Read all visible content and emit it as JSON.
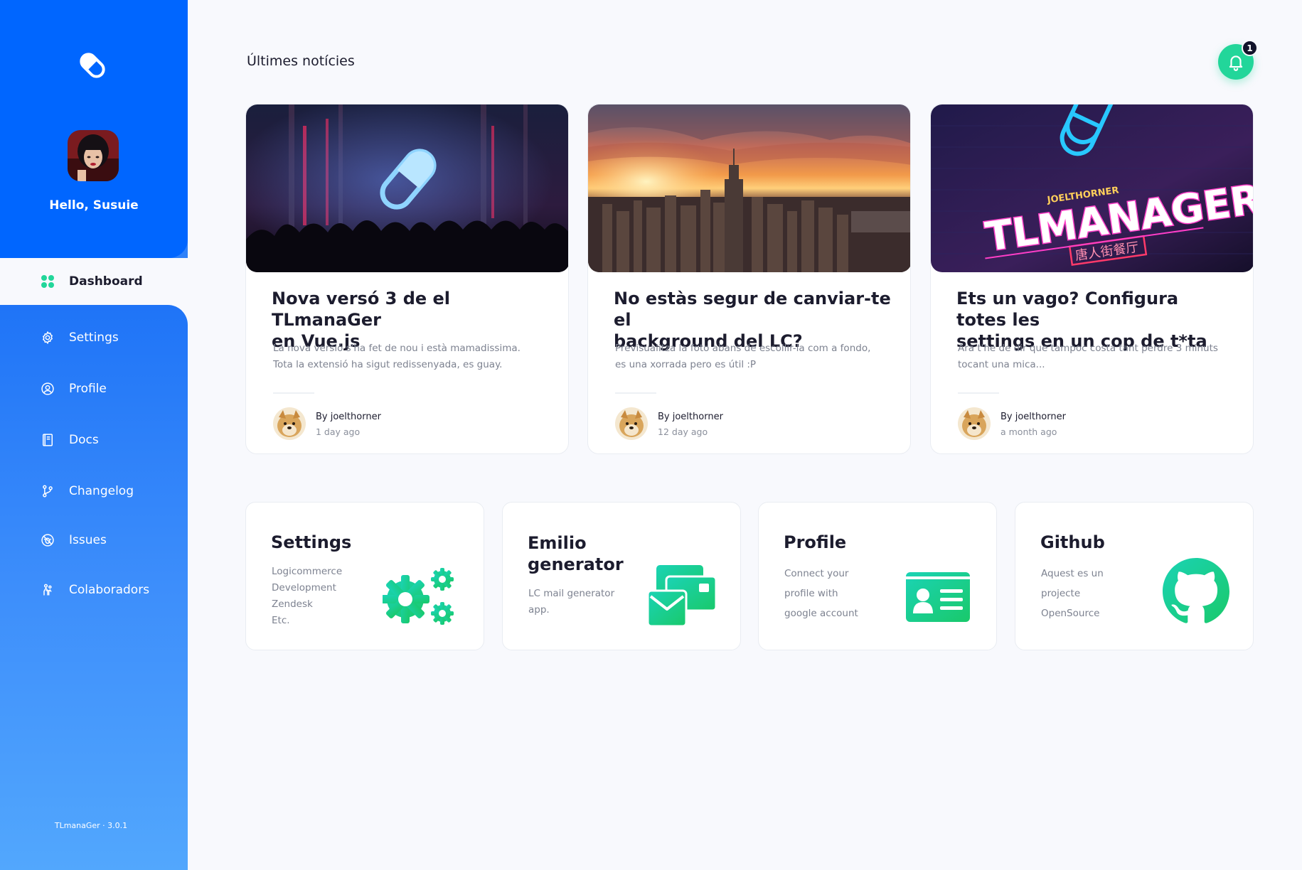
{
  "sidebar": {
    "greeting": "Hello, Susuie",
    "version": "TLmanaGer · 3.0.1",
    "items": [
      {
        "label": "Dashboard"
      },
      {
        "label": "Settings"
      },
      {
        "label": "Profile"
      },
      {
        "label": "Docs"
      },
      {
        "label": "Changelog"
      },
      {
        "label": "Issues"
      },
      {
        "label": "Colaboradors"
      }
    ]
  },
  "header": {
    "title": "Últimes notícies",
    "notification_count": "1"
  },
  "news": [
    {
      "title_l1": "Nova versó 3 de el TLmanaGer",
      "title_l2": "en Vue.js",
      "desc_l1": "La nova versió s'ha fet de nou i està mamadissima.",
      "desc_l2": "Tota la extensió ha sigut redissenyada, es guay.",
      "author": "By joelthorner",
      "time": "1 day ago"
    },
    {
      "title_l1": "No estàs segur de canviar-te el",
      "title_l2": "background del LC?",
      "desc_l1": "Previsualitza  la foto abans de escollir-la com a fondo,",
      "desc_l2": "es una xorrada pero es útil :P",
      "author": "By joelthorner",
      "time": "12 day ago"
    },
    {
      "title_l1": "Ets un vago? Configura totes les",
      "title_l2": "settings en un cop de t*ta",
      "desc_l1": "Ara t'he de dir que tampoc costa tant perdre 3 minuts",
      "desc_l2": "tocant una mica...",
      "author": "By joelthorner",
      "time": "a month ago",
      "img_text_top": "JOELTHORNER",
      "img_text_main": "TLMANAGER",
      "img_text_sub": "唐人街餐厅"
    }
  ],
  "tools": [
    {
      "title_l1": "Settings",
      "title_l2": "",
      "lines": [
        "Logicommerce",
        "Development",
        "Zendesk",
        "Etc."
      ]
    },
    {
      "title_l1": "Emilio",
      "title_l2": "generator",
      "lines": [
        "LC mail  generator",
        "app."
      ]
    },
    {
      "title_l1": "Profile",
      "title_l2": "",
      "lines": [
        "Connect your",
        "profile with",
        "google account"
      ]
    },
    {
      "title_l1": "Github",
      "title_l2": "",
      "lines": [
        "Aquest es un",
        "projecte",
        "OpenSource"
      ]
    }
  ],
  "colors": {
    "primary": "#0066ff",
    "accent": "#22d69a",
    "text_dark": "#1c1c2e",
    "text_muted": "#7d8290"
  },
  "icons": [
    "pill-logo-icon",
    "bell-icon",
    "dashboard-icon",
    "gear-icon",
    "user-circle-icon",
    "book-icon",
    "git-branch-icon",
    "bug-icon",
    "collaborators-icon",
    "gears-icon",
    "mail-stack-icon",
    "id-card-icon",
    "github-icon"
  ]
}
